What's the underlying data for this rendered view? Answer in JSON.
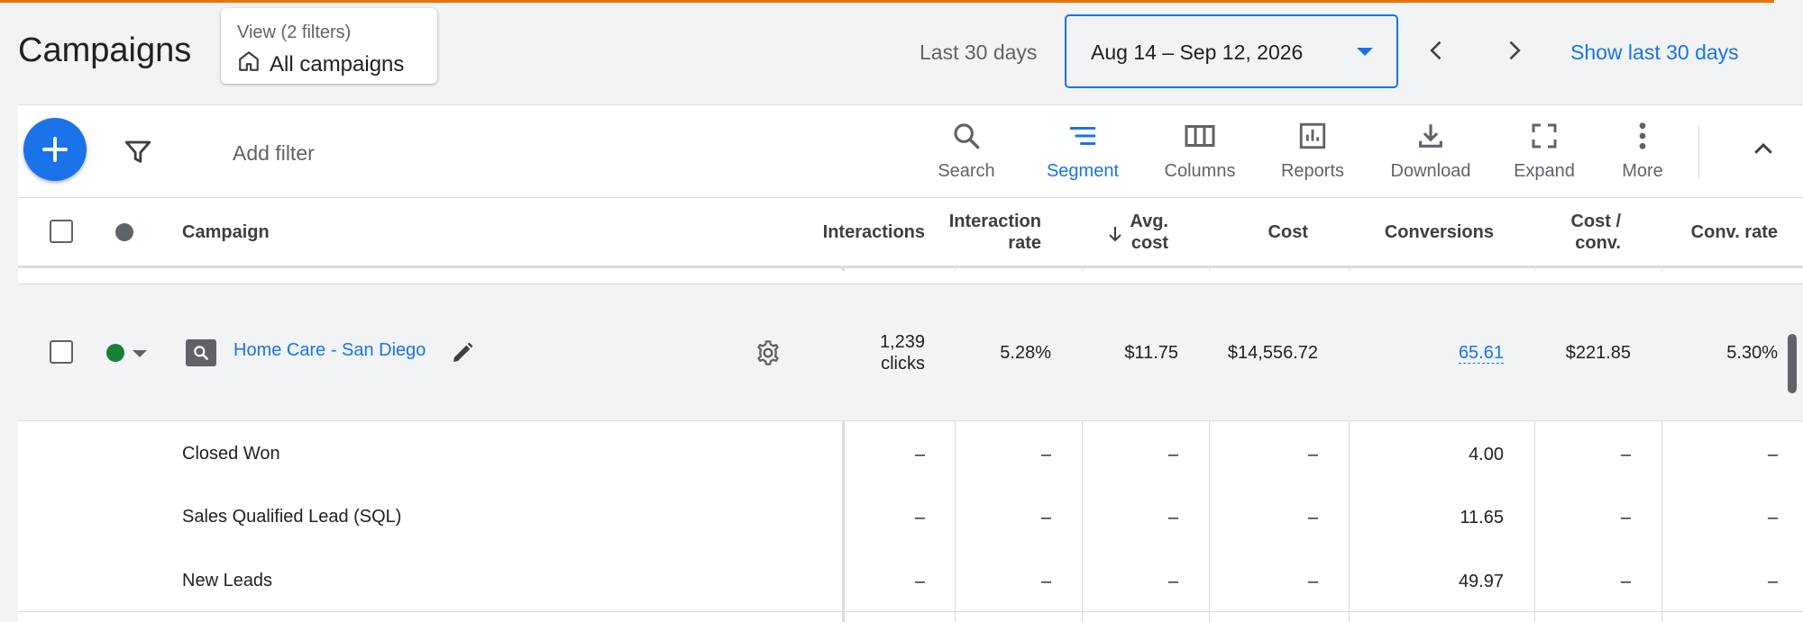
{
  "header": {
    "title": "Campaigns",
    "view_filters": "View (2 filters)",
    "view_name": "All campaigns",
    "date_preset": "Last 30 days",
    "date_range": "Aug 14 – Sep 12, 2026",
    "show_last": "Show last 30 days"
  },
  "toolbar": {
    "add_filter": "Add filter",
    "tools": [
      {
        "label": "Search",
        "icon": "search-icon"
      },
      {
        "label": "Segment",
        "icon": "segment-icon",
        "active": true
      },
      {
        "label": "Columns",
        "icon": "columns-icon"
      },
      {
        "label": "Reports",
        "icon": "reports-icon"
      },
      {
        "label": "Download",
        "icon": "download-icon"
      },
      {
        "label": "Expand",
        "icon": "expand-icon"
      },
      {
        "label": "More",
        "icon": "more-vert-icon"
      }
    ]
  },
  "table": {
    "columns": {
      "campaign": "Campaign",
      "interactions": "Interactions",
      "interaction_rate_1": "Interaction",
      "interaction_rate_2": "rate",
      "avg_cost_1": "Avg.",
      "avg_cost_2": "cost",
      "cost": "Cost",
      "conversions": "Conversions",
      "cost_conv_1": "Cost /",
      "cost_conv_2": "conv.",
      "conv_rate": "Conv. rate"
    },
    "campaign_row": {
      "name": "Home Care - San Diego",
      "interactions_1": "1,239",
      "interactions_2": "clicks",
      "interaction_rate": "5.28%",
      "avg_cost": "$11.75",
      "cost": "$14,556.72",
      "conversions": "65.61",
      "cost_conv": "$221.85",
      "conv_rate": "5.30%"
    },
    "segments": [
      {
        "label": "Closed Won",
        "interactions": "–",
        "interaction_rate": "–",
        "avg_cost": "–",
        "cost": "–",
        "conversions": "4.00",
        "cost_conv": "–",
        "conv_rate": "–"
      },
      {
        "label": "Sales Qualified Lead (SQL)",
        "interactions": "–",
        "interaction_rate": "–",
        "avg_cost": "–",
        "cost": "–",
        "conversions": "11.65",
        "cost_conv": "–",
        "conv_rate": "–"
      },
      {
        "label": "New Leads",
        "interactions": "–",
        "interaction_rate": "–",
        "avg_cost": "–",
        "cost": "–",
        "conversions": "49.97",
        "cost_conv": "–",
        "conv_rate": "–"
      }
    ]
  },
  "colors": {
    "accent": "#1a73e8",
    "status_enabled": "#188038",
    "top_line": "#e8710a"
  }
}
